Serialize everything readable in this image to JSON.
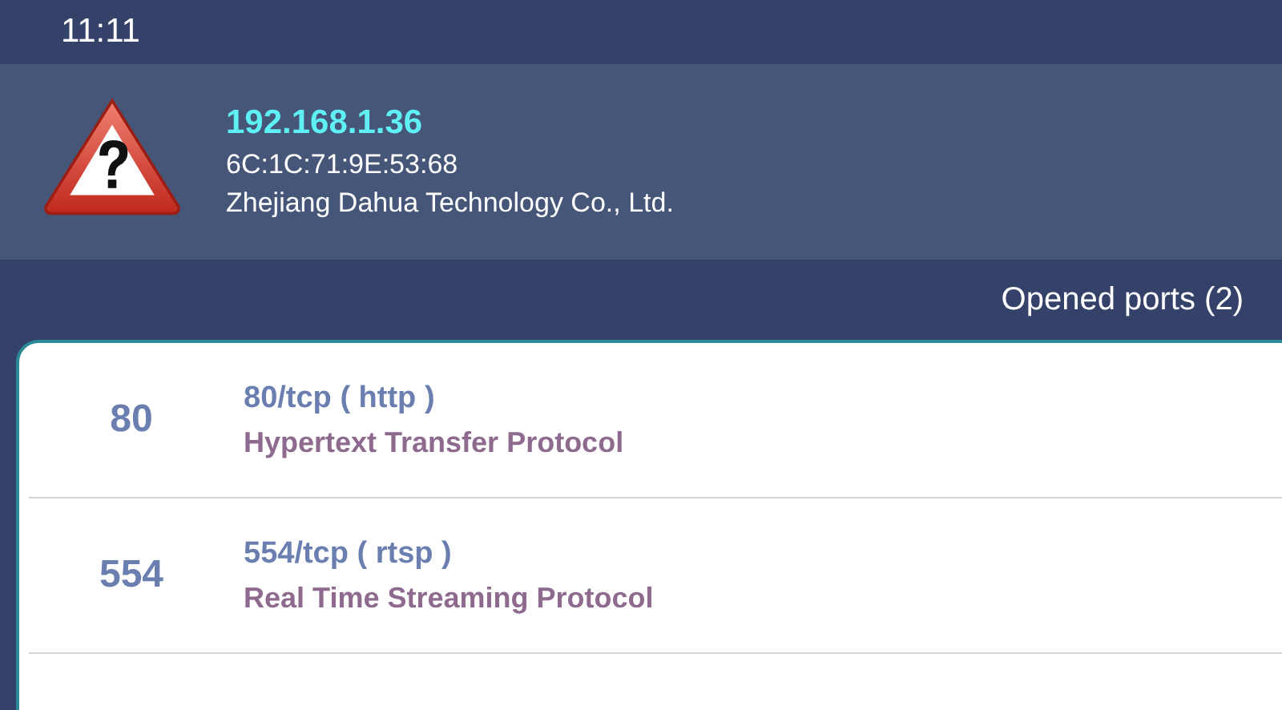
{
  "status_bar": {
    "time": "11:11"
  },
  "device": {
    "ip": "192.168.1.36",
    "mac": "6C:1C:71:9E:53:68",
    "vendor": "Zhejiang Dahua Technology Co., Ltd."
  },
  "ports_header": "Opened ports (2)",
  "ports": [
    {
      "number": "80",
      "service": "80/tcp ( http )",
      "description": "Hypertext Transfer Protocol"
    },
    {
      "number": "554",
      "service": "554/tcp ( rtsp )",
      "description": "Real Time Streaming Protocol"
    }
  ]
}
